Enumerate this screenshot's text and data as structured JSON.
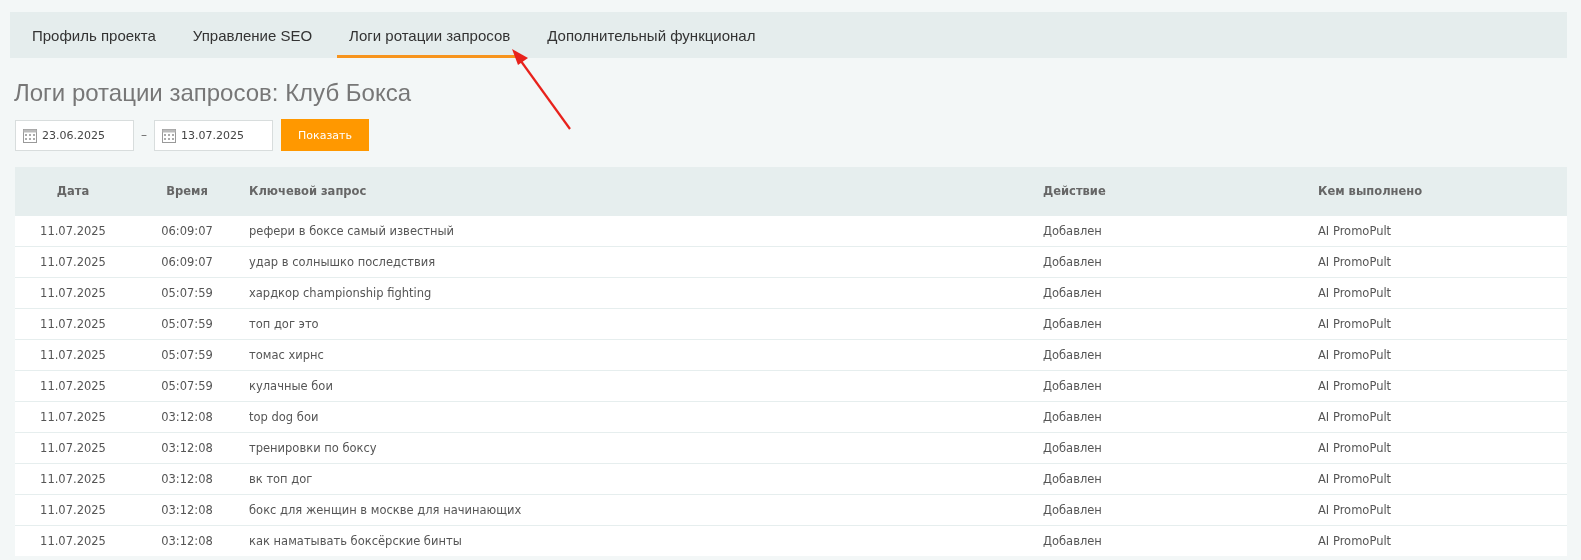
{
  "tabs": [
    {
      "label": "Профиль проекта",
      "selected": false
    },
    {
      "label": "Управление SEO",
      "selected": false
    },
    {
      "label": "Логи ротации запросов",
      "selected": true
    },
    {
      "label": "Дополнительный функционал",
      "selected": false
    }
  ],
  "page_title": "Логи ротации запросов: Клуб Бокса",
  "filter": {
    "date_from": "23.06.2025",
    "separator": "–",
    "date_to": "13.07.2025",
    "button": "Показать"
  },
  "table": {
    "columns": [
      "Дата",
      "Время",
      "Ключевой запрос",
      "Действие",
      "Кем выполнено"
    ],
    "rows": [
      [
        "11.07.2025",
        "06:09:07",
        "рефери в боксе самый известный",
        "Добавлен",
        "AI PromoPult"
      ],
      [
        "11.07.2025",
        "06:09:07",
        "удар в солнышко последствия",
        "Добавлен",
        "AI PromoPult"
      ],
      [
        "11.07.2025",
        "05:07:59",
        "хардкор championship fighting",
        "Добавлен",
        "AI PromoPult"
      ],
      [
        "11.07.2025",
        "05:07:59",
        "топ дог это",
        "Добавлен",
        "AI PromoPult"
      ],
      [
        "11.07.2025",
        "05:07:59",
        "томас хирнс",
        "Добавлен",
        "AI PromoPult"
      ],
      [
        "11.07.2025",
        "05:07:59",
        "кулачные бои",
        "Добавлен",
        "AI PromoPult"
      ],
      [
        "11.07.2025",
        "03:12:08",
        "top dog бои",
        "Добавлен",
        "AI PromoPult"
      ],
      [
        "11.07.2025",
        "03:12:08",
        "тренировки по боксу",
        "Добавлен",
        "AI PromoPult"
      ],
      [
        "11.07.2025",
        "03:12:08",
        "вк топ дог",
        "Добавлен",
        "AI PromoPult"
      ],
      [
        "11.07.2025",
        "03:12:08",
        "бокс для женщин в москве для начинающих",
        "Добавлен",
        "AI PromoPult"
      ],
      [
        "11.07.2025",
        "03:12:08",
        "как наматывать боксёрские бинты",
        "Добавлен",
        "AI PromoPult"
      ]
    ]
  }
}
